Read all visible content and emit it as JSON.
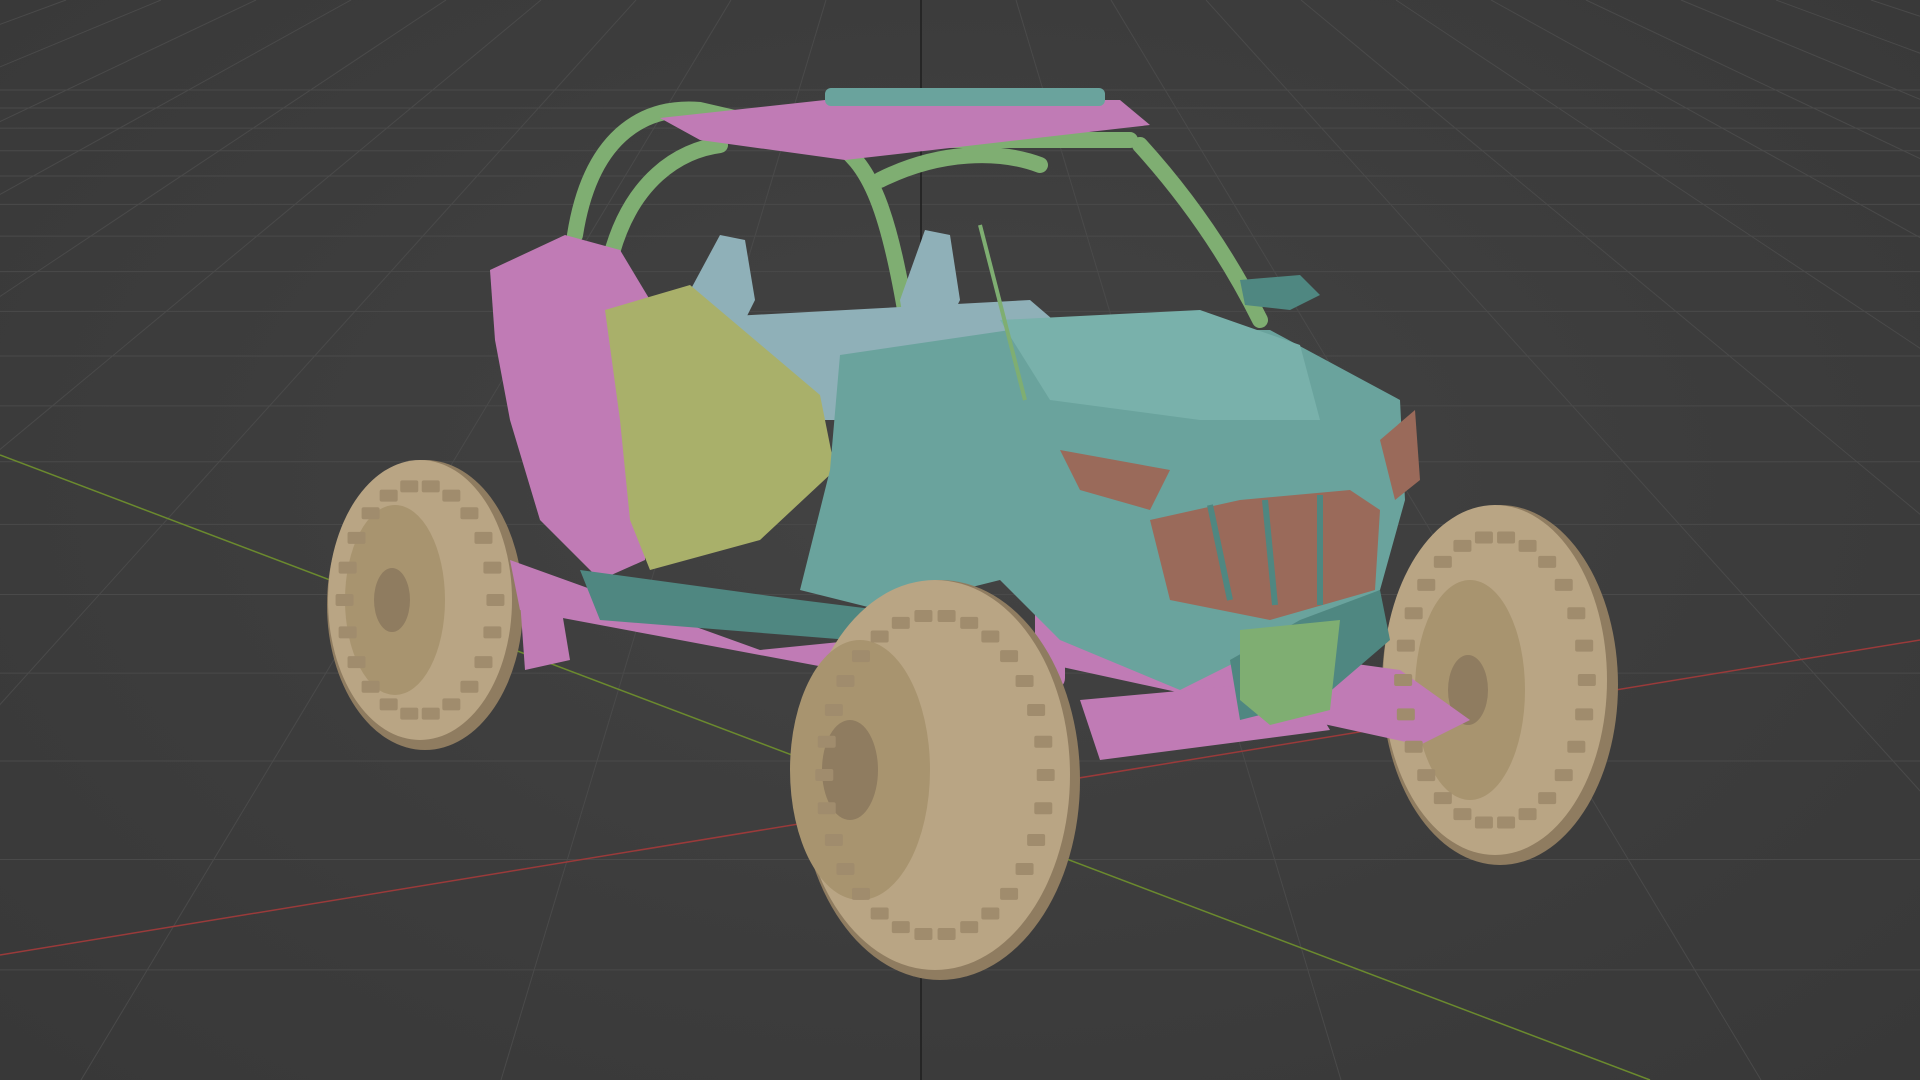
{
  "viewport": {
    "background": "#3d3d3d",
    "grid_color": "#4a4a4a",
    "axis_x_color": "#9a3a3a",
    "axis_y_color": "#6b8a2e",
    "cursor_line_color": "#1e1e1e"
  },
  "model": {
    "name": "side-by-side-buggy",
    "material_colors": {
      "body_teal": "#6aa39d",
      "body_teal_dark": "#4f8781",
      "frame_green": "#7fae72",
      "trim_pink": "#c07bb5",
      "side_panel_olive": "#a9b06a",
      "tire_tan": "#b9a584",
      "tire_tan_dark": "#8f7c60",
      "glass_copper": "#9a6a5a",
      "seat_blue": "#8fb0b8"
    }
  }
}
